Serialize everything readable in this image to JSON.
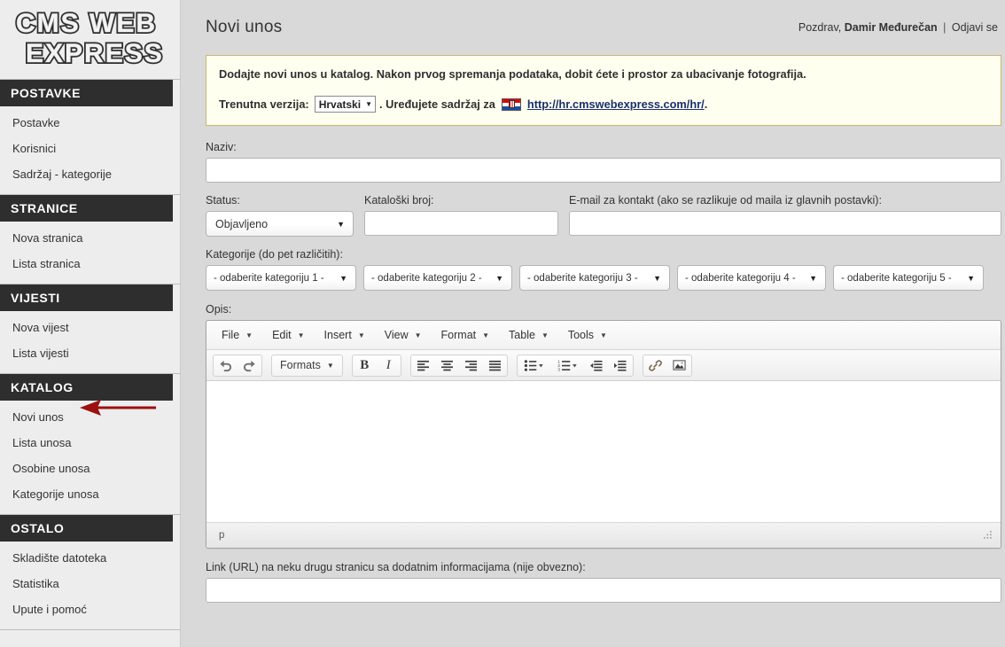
{
  "app": {
    "logo_line1": "CMS WEB",
    "logo_line2": "EXPRESS"
  },
  "sidebar": {
    "groups": [
      {
        "header": "POSTAVKE",
        "items": [
          {
            "label": "Postavke"
          },
          {
            "label": "Korisnici"
          },
          {
            "label": "Sadržaj - kategorije"
          }
        ]
      },
      {
        "header": "STRANICE",
        "items": [
          {
            "label": "Nova stranica"
          },
          {
            "label": "Lista stranica"
          }
        ]
      },
      {
        "header": "VIJESTI",
        "items": [
          {
            "label": "Nova vijest"
          },
          {
            "label": "Lista vijesti"
          }
        ]
      },
      {
        "header": "KATALOG",
        "items": [
          {
            "label": "Novi unos"
          },
          {
            "label": "Lista unosa"
          },
          {
            "label": "Osobine unosa"
          },
          {
            "label": "Kategorije unosa"
          }
        ]
      },
      {
        "header": "OSTALO",
        "items": [
          {
            "label": "Skladište datoteka"
          },
          {
            "label": "Statistika"
          },
          {
            "label": "Upute i pomoć"
          }
        ]
      }
    ]
  },
  "header": {
    "title": "Novi unos",
    "greeting_prefix": "Pozdrav,",
    "user_name": "Damir Međurečan",
    "separator": "|",
    "logout_label": "Odjavi se"
  },
  "notice": {
    "line1": "Dodajte novi unos u katalog. Nakon prvog spremanja podataka, dobit ćete i prostor za ubacivanje fotografija.",
    "version_label": "Trenutna verzija:",
    "version_value": "Hrvatski",
    "after_select": ". Uređujete sadržaj za",
    "flag_name": "croatia-flag-icon",
    "url": "http://hr.cmswebexpress.com/hr/",
    "url_suffix": ".",
    "bg_color": "#fffff0",
    "border_color": "#c8b871",
    "link_color": "#1a2f6e"
  },
  "form": {
    "naziv_label": "Naziv:",
    "naziv_value": "",
    "naziv_placeholder": "",
    "status_label": "Status:",
    "status_value": "Objavljeno",
    "kataloski_label": "Kataloški broj:",
    "kataloski_value": "",
    "email_label": "E-mail za kontakt (ako se razlikuje od maila iz glavnih postavki):",
    "email_value": "",
    "kategorije_label": "Kategorije (do pet različitih):",
    "kategorije": [
      "- odaberite kategoriju 1 -",
      "- odaberite kategoriju 2 -",
      "- odaberite kategoriju 3 -",
      "- odaberite kategoriju 4 -",
      "- odaberite kategoriju 5 -"
    ],
    "opis_label": "Opis:",
    "link_label": "Link (URL) na neku drugu stranicu sa dodatnim informacijama (nije obvezno):",
    "link_value": ""
  },
  "editor": {
    "menubar": [
      "File",
      "Edit",
      "Insert",
      "View",
      "Format",
      "Table",
      "Tools"
    ],
    "formats_label": "Formats",
    "toolbar_icons": [
      "undo-icon",
      "redo-icon",
      "formats-dropdown",
      "bold-icon",
      "italic-icon",
      "align-left-icon",
      "align-center-icon",
      "align-right-icon",
      "align-justify-icon",
      "bullet-list-icon",
      "numbered-list-icon",
      "outdent-icon",
      "indent-icon",
      "link-icon",
      "image-icon"
    ],
    "content": "",
    "status_path": "p"
  },
  "annotation": {
    "arrow_color": "#9c1010",
    "points_to": "Novi unos"
  },
  "colors": {
    "page_bg": "#d9d9d9",
    "sidebar_bg": "#ededed",
    "nav_header_bg": "#2e2e2e",
    "nav_header_text": "#ffffff"
  }
}
